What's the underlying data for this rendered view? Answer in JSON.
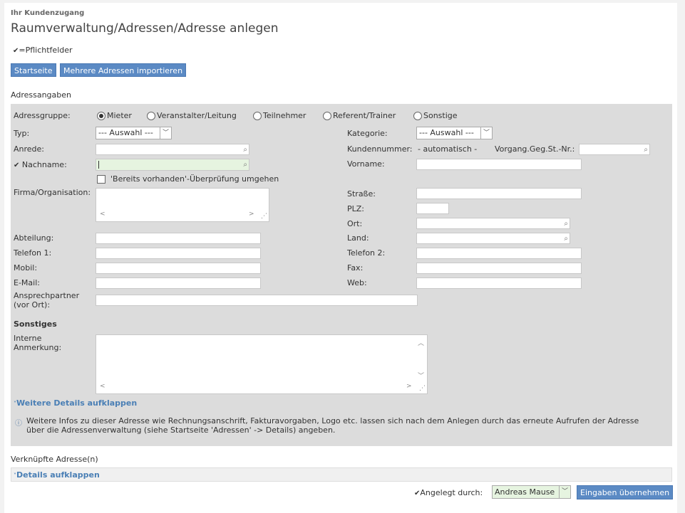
{
  "header": {
    "section_label": "Ihr Kundenzugang",
    "title": "Raumverwaltung/Adressen/Adresse anlegen",
    "required_note": "=Pflichtfelder"
  },
  "toolbar": {
    "start_label": "Startseite",
    "import_label": "Mehrere Adressen importieren"
  },
  "address_section": {
    "heading": "Adressangaben",
    "group_label": "Adressgruppe:",
    "groups": [
      "Mieter",
      "Veranstalter/Leitung",
      "Teilnehmer",
      "Referent/Trainer",
      "Sonstige"
    ],
    "selected_group": "Mieter",
    "typ_label": "Typ:",
    "typ_value": "--- Auswahl ---",
    "kategorie_label": "Kategorie:",
    "kategorie_value": "--- Auswahl ---",
    "anrede_label": "Anrede:",
    "kundennummer_label": "Kundennummer:",
    "kundennummer_value": "- automatisch -",
    "vorgang_label": "Vorgang.Geg.St.-Nr.:",
    "nachname_label": "Nachname:",
    "vorname_label": "Vorname:",
    "bypass_label": "'Bereits vorhanden'-Überprüfung umgehen",
    "firma_label": "Firma/Organisation:",
    "strasse_label": "Straße:",
    "plz_label": "PLZ:",
    "ort_label": "Ort:",
    "abteilung_label": "Abteilung:",
    "land_label": "Land:",
    "telefon1_label": "Telefon 1:",
    "telefon2_label": "Telefon 2:",
    "mobil_label": "Mobil:",
    "fax_label": "Fax:",
    "email_label": "E-Mail:",
    "web_label": "Web:",
    "ansprechpartner_label_1": "Ansprechpartner",
    "ansprechpartner_label_2": "(vor Ort):",
    "sonstiges_heading": "Sonstiges",
    "interne_label_1": "Interne",
    "interne_label_2": "Anmerkung:",
    "more_details_link": "Weitere Details aufklappen",
    "info_line_1": "Weitere Infos zu dieser Adresse wie Rechnungsanschrift, Fakturavorgaben, Logo etc. lassen sich nach dem Anlegen durch das erneute Aufrufen der Adresse",
    "info_line_2": "über die Adressenverwaltung (siehe Startseite 'Adressen' -> Details) angeben."
  },
  "linked": {
    "heading": "Verknüpfte Adresse(n)",
    "details_link": "Details aufklappen"
  },
  "footer": {
    "created_by_label": "Angelegt durch:",
    "created_by_value": "Andreas Mause",
    "submit_label": "Eingaben übernehmen"
  },
  "colors": {
    "button": "#5b8ac4",
    "panel": "#dcdcdc",
    "link": "#4a7fb5",
    "highlight_input": "#e6f4e0"
  }
}
